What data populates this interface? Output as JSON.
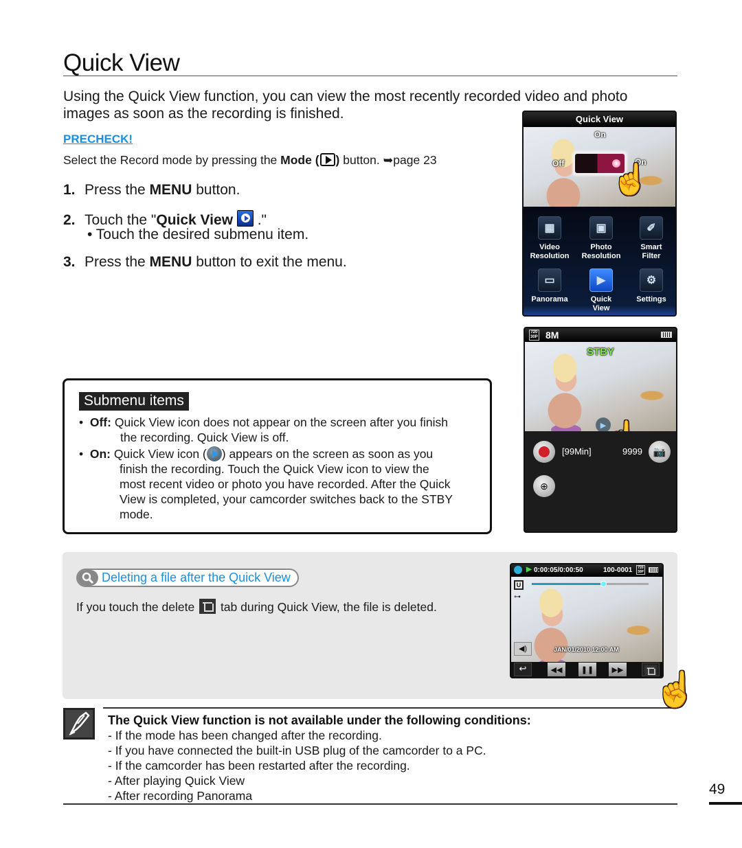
{
  "page": {
    "title": "Quick View",
    "intro": "Using the Quick View function, you can view the most recently recorded video and photo images as soon as the recording is finished.",
    "page_number": "49"
  },
  "precheck": {
    "heading": "PRECHECK!",
    "text_before": "Select the Record mode by pressing the ",
    "mode_label": "Mode (",
    "mode_close": ")",
    "text_after": " button. ",
    "page_ref": "➥page 23"
  },
  "steps": [
    {
      "num": "1.",
      "before": "Press the ",
      "bold": "MENU",
      "after": " button."
    },
    {
      "num": "2.",
      "before": "Touch the \"",
      "bold": "Quick View",
      "after": " .\"",
      "sub": "•  Touch the desired submenu item."
    },
    {
      "num": "3.",
      "before": "Press the ",
      "bold": "MENU",
      "after": " button to exit the menu."
    }
  ],
  "submenu": {
    "heading": "Submenu items",
    "items": [
      {
        "label": "Off:",
        "text_lines": [
          "Quick View icon does not appear on the screen after you finish",
          "the recording. Quick View is off."
        ]
      },
      {
        "label": "On:",
        "text_lines": [
          "Quick View icon (",
          ") appears on the screen as soon as you",
          "finish the recording. Touch the Quick View icon to view the",
          "most recent video or photo you have recorded. After the Quick",
          "View is completed, your camcorder switches back to the STBY",
          "mode."
        ]
      }
    ]
  },
  "tip": {
    "title": "Deleting a file after the Quick View",
    "text_before": "If you touch the delete ",
    "text_after": " tab during Quick View, the file is deleted."
  },
  "note": {
    "title": "The Quick View function is not available under the following conditions:",
    "items": [
      "- If the mode has been changed after the recording.",
      "- If you have connected the built-in USB plug of the camcorder to a PC.",
      "- If the camcorder has been restarted after the recording.",
      "- After playing Quick View",
      "- After recording Panorama"
    ]
  },
  "screen_menu": {
    "title": "Quick View",
    "option_top": "On",
    "option_off": "Off",
    "option_on": "On",
    "toggle_state": "On",
    "items": [
      {
        "label1": "Video",
        "label2": "Resolution",
        "icon": "video-resolution-icon",
        "glyph": "▦"
      },
      {
        "label1": "Photo",
        "label2": "Resolution",
        "icon": "photo-resolution-icon",
        "glyph": "▣"
      },
      {
        "label1": "Smart",
        "label2": "Filter",
        "icon": "smart-filter-icon",
        "glyph": "✐"
      },
      {
        "label1": "Panorama",
        "label2": "",
        "icon": "panorama-icon",
        "glyph": "▭"
      },
      {
        "label1": "Quick",
        "label2": "View",
        "icon": "quick-view-icon",
        "glyph": "▶"
      },
      {
        "label1": "Settings",
        "label2": "",
        "icon": "settings-icon",
        "glyph": "⚙"
      }
    ]
  },
  "screen_stby": {
    "res_top": "720",
    "res_bottom": "30P",
    "photo_size": "8M",
    "status": "STBY",
    "remaining": "[99Min]",
    "photo_count": "9999",
    "status_color": "#7de84a"
  },
  "screen_playback": {
    "time": "0:00:05/0:00:50",
    "file_no": "100-0001",
    "res_top": "720",
    "res_bottom": "30P",
    "date": "JAN/01/2010 12:00 AM",
    "progress": 0.62
  },
  "colors": {
    "accent_blue": "#1a8fe0",
    "tip_bg": "#e8e8e8"
  }
}
